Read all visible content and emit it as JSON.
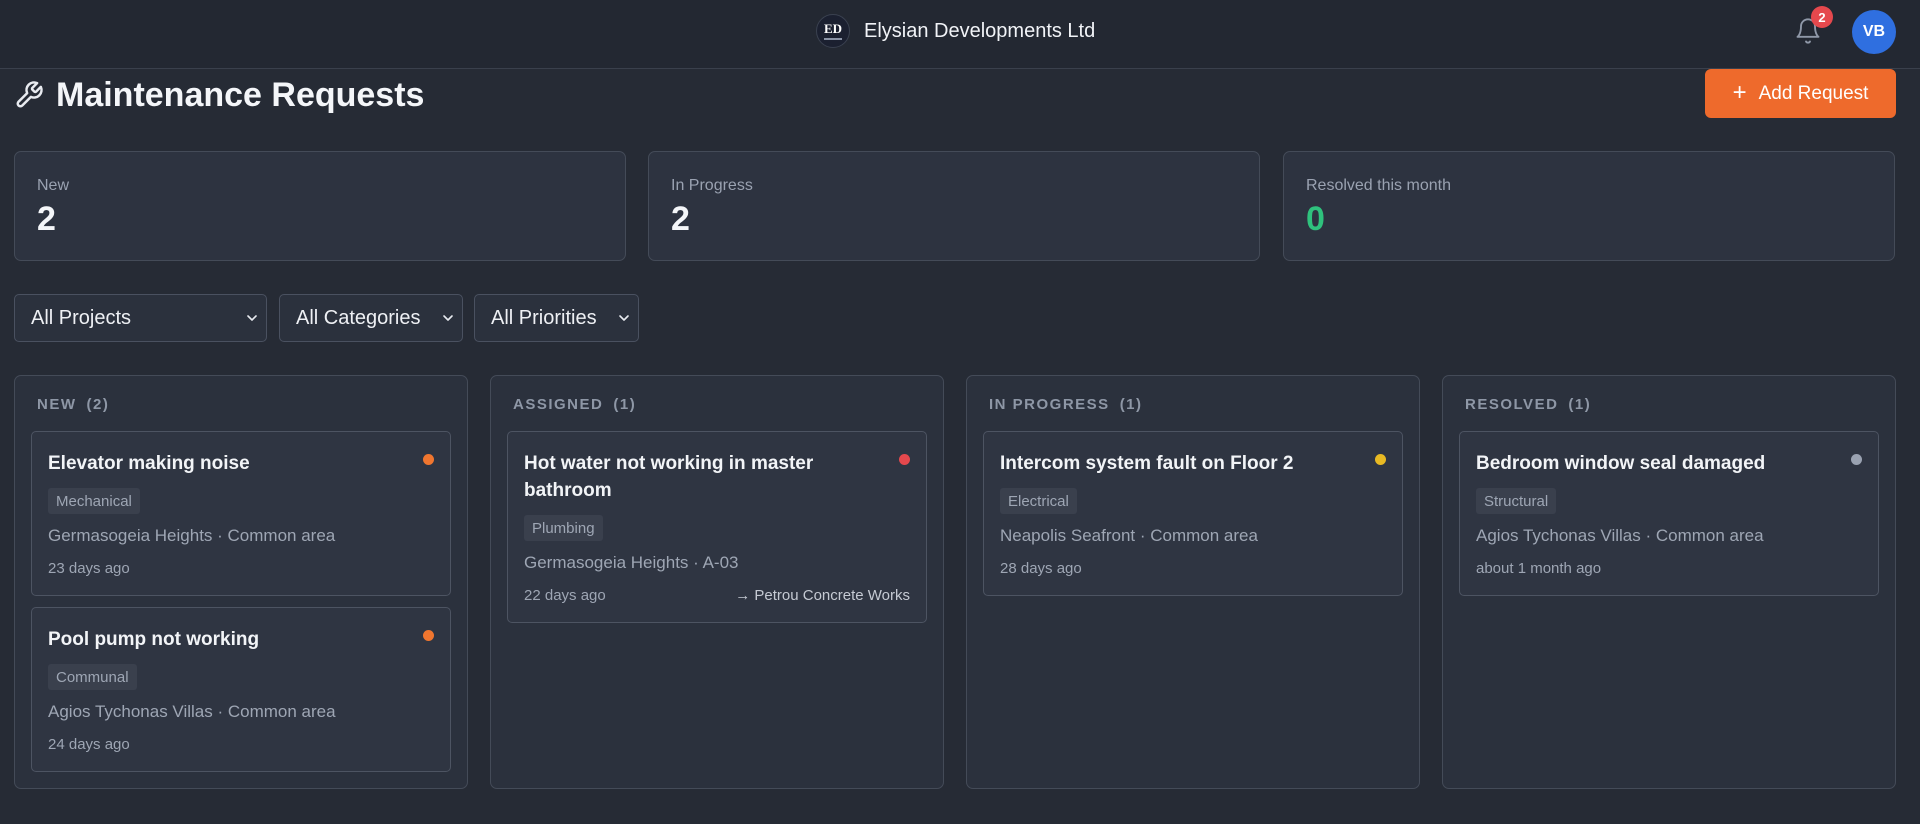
{
  "app": {
    "company_name": "Elysian Developments Ltd",
    "logo_text": "ED",
    "notification_count": "2",
    "user_initials": "VB"
  },
  "page": {
    "title": "Maintenance Requests",
    "add_button_label": "Add Request"
  },
  "stats": [
    {
      "label": "New",
      "value": "2"
    },
    {
      "label": "In Progress",
      "value": "2"
    },
    {
      "label": "Resolved this month",
      "value": "0"
    }
  ],
  "filters": [
    {
      "selected": "All Projects"
    },
    {
      "selected": "All Categories"
    },
    {
      "selected": "All Priorities"
    }
  ],
  "columns": [
    {
      "title": "NEW",
      "count": "(2)",
      "cards": [
        {
          "title": "Elevator making noise",
          "category": "Mechanical",
          "location": "Germasogeia Heights · Common area",
          "age": "23 days ago",
          "priority_color": "#f0762f"
        },
        {
          "title": "Pool pump not working",
          "category": "Communal",
          "location": "Agios Tychonas Villas · Common area",
          "age": "24 days ago",
          "priority_color": "#f0762f"
        }
      ]
    },
    {
      "title": "ASSIGNED",
      "count": "(1)",
      "cards": [
        {
          "title": "Hot water not working in master bathroom",
          "category": "Plumbing",
          "location": "Germasogeia Heights · A-03",
          "age": "22 days ago",
          "assignee": "→ Petrou Concrete Works",
          "priority_color": "#e5484d"
        }
      ]
    },
    {
      "title": "IN PROGRESS",
      "count": "(1)",
      "cards": [
        {
          "title": "Intercom system fault on Floor 2",
          "category": "Electrical",
          "location": "Neapolis Seafront · Common area",
          "age": "28 days ago",
          "priority_color": "#e8b923"
        }
      ]
    },
    {
      "title": "RESOLVED",
      "count": "(1)",
      "cards": [
        {
          "title": "Bedroom window seal damaged",
          "category": "Structural",
          "location": "Agios Tychonas Villas · Common area",
          "age": "about 1 month ago",
          "priority_color": "#9aa2b1"
        }
      ]
    }
  ],
  "colors": {
    "accent": "#ee6a2c",
    "resolved_value": "#2fc27d",
    "background": "#262b35"
  }
}
